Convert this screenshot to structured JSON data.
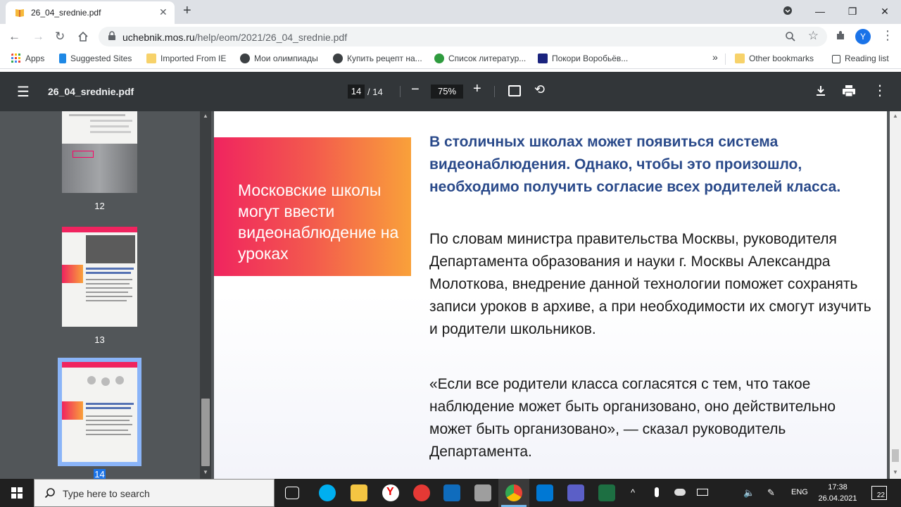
{
  "browser": {
    "tab_title": "26_04_srednie.pdf",
    "tab_close": "✕",
    "new_tab": "+",
    "url_host": "uchebnik.mos.ru",
    "url_path": "/help/eom/2021/26_04_srednie.pdf",
    "avatar_letter": "Y",
    "window_minimize": "—",
    "window_restore": "❐",
    "window_close": "✕"
  },
  "bookmarks": {
    "apps": "Apps",
    "suggested": "Suggested Sites",
    "imported": "Imported From IE",
    "olympiads": "Мои олимпиады",
    "recipe": "Купить рецепт на...",
    "literature": "Список литератур...",
    "vorobyevy": "Покори Воробьёв...",
    "more": "»",
    "other": "Other bookmarks",
    "reading_list": "Reading list"
  },
  "pdf_toolbar": {
    "title": "26_04_srednie.pdf",
    "current_page": "14",
    "total_pages": "/ 14",
    "zoom": "75%",
    "zoom_out": "−",
    "zoom_in": "+"
  },
  "thumbnails": [
    {
      "label": "12"
    },
    {
      "label": "13"
    },
    {
      "label": "14"
    }
  ],
  "page": {
    "banner": "Московские школы могут ввести видеонаблюдение на уроках",
    "lead": "В столичных школах может появиться система видеонаблюдения. Однако, чтобы это произошло, необходимо получить согласие всех родителей класса.",
    "body1": "По словам министра правительства Москвы, руководителя Департамента образования и науки г. Москвы Александра Молоткова, внедрение данной технологии поможет сохранять записи уроков в архиве, а при необходимости их смогут изучить и родители школьников.",
    "body2": "«Если все родители класса согласятся с тем, что такое наблюдение может быть организовано, оно действительно может быть организовано», — сказал руководитель Департамента."
  },
  "taskbar": {
    "search_placeholder": "Type here to search",
    "lang": "ENG",
    "time": "17:38",
    "date": "26.04.2021",
    "notifications": "22"
  },
  "colors": {
    "banner_start": "#f0245f",
    "banner_end": "#f9a13a",
    "lead_text": "#2a4a8a",
    "pdf_toolbar": "#323639",
    "viewer_bg": "#525659",
    "thumb_selected": "#8ab4f8"
  }
}
